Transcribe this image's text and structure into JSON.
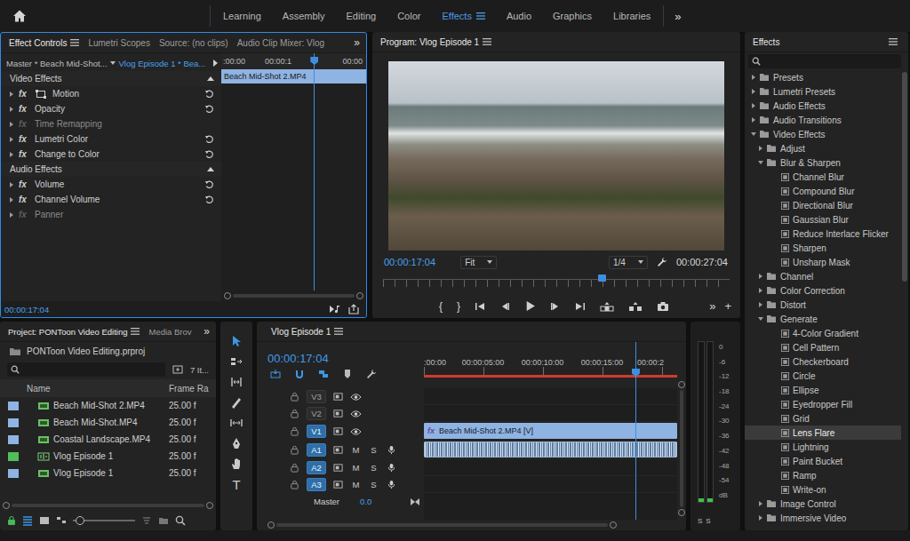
{
  "workspaces": {
    "tabs": [
      {
        "label": "Learning",
        "selected": false
      },
      {
        "label": "Assembly",
        "selected": false
      },
      {
        "label": "Editing",
        "selected": false
      },
      {
        "label": "Color",
        "selected": false
      },
      {
        "label": "Effects",
        "selected": true
      },
      {
        "label": "Audio",
        "selected": false
      },
      {
        "label": "Graphics",
        "selected": false
      },
      {
        "label": "Libraries",
        "selected": false
      }
    ],
    "overflow": "»"
  },
  "effect_controls": {
    "tabs": [
      {
        "label": "Effect Controls",
        "selected": true
      },
      {
        "label": "Lumetri Scopes",
        "selected": false
      },
      {
        "label": "Source: (no clips)",
        "selected": false
      },
      {
        "label": "Audio Clip Mixer: Vlog",
        "selected": false
      }
    ],
    "overflow": "»",
    "source": "Master * Beach Mid-Shot...",
    "sequence": "Vlog Episode 1 * Bea...",
    "ruler": [
      ":00:00",
      "00:00:1",
      "00:00"
    ],
    "clip": "Beach Mid-Shot 2.MP4",
    "playhead_level": 0.64,
    "sections": [
      {
        "title": "Video Effects",
        "effects": [
          {
            "name": "Motion",
            "badge": "fx",
            "kind": "motion",
            "enabled": true
          },
          {
            "name": "Opacity",
            "badge": "fx",
            "kind": "standard",
            "enabled": true
          },
          {
            "name": "Time Remapping",
            "badge": "fx",
            "kind": "standard",
            "enabled": false
          },
          {
            "name": "Lumetri Color",
            "badge": "fx",
            "kind": "standard",
            "enabled": true
          },
          {
            "name": "Change to Color",
            "badge": "fx",
            "kind": "standard",
            "enabled": true
          }
        ]
      },
      {
        "title": "Audio Effects",
        "effects": [
          {
            "name": "Volume",
            "badge": "fx",
            "kind": "standard",
            "enabled": true
          },
          {
            "name": "Channel Volume",
            "badge": "fx",
            "kind": "standard",
            "enabled": true
          },
          {
            "name": "Panner",
            "badge": "fx",
            "kind": "standard",
            "enabled": false
          }
        ]
      }
    ],
    "timecode": "00:00:17:04"
  },
  "program": {
    "title": "Program: Vlog Episode 1",
    "timecode": "00:00:17:04",
    "zoom": "Fit",
    "resolution": "1/4",
    "duration": "00:00:27:04",
    "playhead_level": 0.63,
    "mark_in": "{",
    "mark_out": "}",
    "overflow": "»",
    "add": "+"
  },
  "project": {
    "tabs": [
      {
        "label": "Project: PONToon Video Editing",
        "selected": true
      },
      {
        "label": "Media Brov",
        "selected": false
      }
    ],
    "overflow": "»",
    "file": "PONToon Video Editing.prproj",
    "count": "7 It...",
    "columns": [
      "Name",
      "Frame Ra"
    ],
    "items": [
      {
        "name": "Beach Mid-Shot 2.MP4",
        "rate": "25.00 f",
        "kind": "clip",
        "color": "#8fb4e3"
      },
      {
        "name": "Beach Mid-Shot.MP4",
        "rate": "25.00 f",
        "kind": "clip",
        "color": "#8fb4e3"
      },
      {
        "name": "Coastal Landscape.MP4",
        "rate": "25.00 f",
        "kind": "clip",
        "color": "#8fb4e3"
      },
      {
        "name": "Vlog Episode 1",
        "rate": "25.00 f",
        "kind": "sequence",
        "color": "#4fbf5a"
      },
      {
        "name": "Vlog Episode 1",
        "rate": "25.00 f",
        "kind": "clip",
        "color": "#8fb4e3"
      }
    ],
    "zoom_level": 0.12
  },
  "tools": [
    {
      "kind": "selection",
      "selected": true
    },
    {
      "kind": "track-select",
      "selected": false
    },
    {
      "kind": "ripple",
      "selected": false
    },
    {
      "kind": "razor",
      "selected": false
    },
    {
      "kind": "slip",
      "selected": false
    },
    {
      "kind": "pen",
      "selected": false
    },
    {
      "kind": "hand",
      "selected": false
    },
    {
      "kind": "type",
      "selected": false,
      "label": "T"
    }
  ],
  "timeline": {
    "title": "Vlog Episode 1",
    "timecode": "00:00:17:04",
    "ruler": [
      ":00:00",
      "00:00:05:00",
      "00:00:10:00",
      "00:00:15:00",
      "00:00:2"
    ],
    "playhead_level": 0.835,
    "tracks": [
      {
        "name": "V3",
        "kind": "video",
        "targeted": false,
        "clip": null
      },
      {
        "name": "V2",
        "kind": "video",
        "targeted": false,
        "clip": null
      },
      {
        "name": "V1",
        "kind": "video",
        "targeted": true,
        "clip": {
          "label": "Beach Mid-Shot 2.MP4 [V]",
          "badge": "fx",
          "waveform": false
        }
      },
      {
        "name": "A1",
        "kind": "audio",
        "targeted": true,
        "mute": "M",
        "solo": "S",
        "clip": {
          "waveform": true
        }
      },
      {
        "name": "A2",
        "kind": "audio",
        "targeted": true,
        "mute": "M",
        "solo": "S",
        "clip": null
      },
      {
        "name": "A3",
        "kind": "audio",
        "targeted": true,
        "mute": "M",
        "solo": "S",
        "clip": null
      }
    ],
    "master": {
      "label": "Master",
      "value": "0.0"
    }
  },
  "meter": {
    "scale": [
      "0",
      "-6",
      "-12",
      "-18",
      "-24",
      "-30",
      "-36",
      "-42",
      "-48",
      "-54",
      "dB"
    ],
    "solo": [
      "S",
      "S"
    ],
    "levels": [
      0.02,
      0.02
    ]
  },
  "effects": {
    "title": "Effects",
    "tree": [
      {
        "label": "Presets",
        "kind": "folder",
        "expanded": false,
        "selected": false,
        "children": []
      },
      {
        "label": "Lumetri Presets",
        "kind": "folder",
        "expanded": false,
        "selected": false,
        "children": []
      },
      {
        "label": "Audio Effects",
        "kind": "folder",
        "expanded": false,
        "selected": false,
        "children": []
      },
      {
        "label": "Audio Transitions",
        "kind": "folder",
        "expanded": false,
        "selected": false,
        "children": []
      },
      {
        "label": "Video Effects",
        "kind": "folder",
        "expanded": true,
        "selected": false,
        "children": [
          {
            "label": "Adjust",
            "kind": "folder",
            "expanded": false,
            "selected": false,
            "children": []
          },
          {
            "label": "Blur & Sharpen",
            "kind": "folder",
            "expanded": true,
            "selected": false,
            "children": [
              {
                "label": "Channel Blur",
                "kind": "effect",
                "selected": false
              },
              {
                "label": "Compound Blur",
                "kind": "effect",
                "selected": false
              },
              {
                "label": "Directional Blur",
                "kind": "effect",
                "selected": false
              },
              {
                "label": "Gaussian Blur",
                "kind": "effect",
                "selected": false
              },
              {
                "label": "Reduce Interlace Flicker",
                "kind": "effect",
                "selected": false
              },
              {
                "label": "Sharpen",
                "kind": "effect",
                "selected": false
              },
              {
                "label": "Unsharp Mask",
                "kind": "effect",
                "selected": false
              }
            ]
          },
          {
            "label": "Channel",
            "kind": "folder",
            "expanded": false,
            "selected": false,
            "children": []
          },
          {
            "label": "Color Correction",
            "kind": "folder",
            "expanded": false,
            "selected": false,
            "children": []
          },
          {
            "label": "Distort",
            "kind": "folder",
            "expanded": false,
            "selected": false,
            "children": []
          },
          {
            "label": "Generate",
            "kind": "folder",
            "expanded": true,
            "selected": false,
            "children": [
              {
                "label": "4-Color Gradient",
                "kind": "effect",
                "selected": false
              },
              {
                "label": "Cell Pattern",
                "kind": "effect",
                "selected": false
              },
              {
                "label": "Checkerboard",
                "kind": "effect",
                "selected": false
              },
              {
                "label": "Circle",
                "kind": "effect",
                "selected": false
              },
              {
                "label": "Ellipse",
                "kind": "effect",
                "selected": false
              },
              {
                "label": "Eyedropper Fill",
                "kind": "effect",
                "selected": false
              },
              {
                "label": "Grid",
                "kind": "effect",
                "selected": false
              },
              {
                "label": "Lens Flare",
                "kind": "effect",
                "selected": true
              },
              {
                "label": "Lightning",
                "kind": "effect",
                "selected": false
              },
              {
                "label": "Paint Bucket",
                "kind": "effect",
                "selected": false
              },
              {
                "label": "Ramp",
                "kind": "effect",
                "selected": false
              },
              {
                "label": "Write-on",
                "kind": "effect",
                "selected": false
              }
            ]
          },
          {
            "label": "Image Control",
            "kind": "folder",
            "expanded": false,
            "selected": false,
            "children": []
          },
          {
            "label": "Immersive Video",
            "kind": "folder",
            "expanded": false,
            "selected": false,
            "children": []
          }
        ]
      }
    ]
  }
}
